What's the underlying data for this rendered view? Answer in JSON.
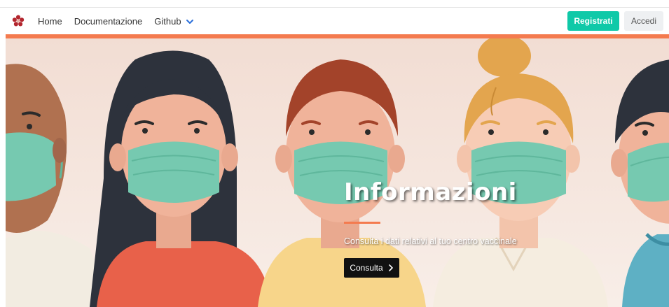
{
  "nav": {
    "logo": "flower-logo-icon",
    "links": [
      "Home",
      "Documentazione"
    ],
    "dropdown_label": "Github",
    "dropdown_icon": "chevron-down-icon",
    "register_label": "Registrati",
    "login_label": "Accedi"
  },
  "hero": {
    "title": "Informazioni",
    "subtitle": "Consulta i dati relativi al tuo centro vaccinale",
    "button_label": "Consulta",
    "button_icon": "chevron-right-icon",
    "illustration": "people-wearing-masks-illustration"
  },
  "colors": {
    "brand_accent": "#f47b4f",
    "register_button": "#0fc9a8",
    "login_button": "#eef0f2",
    "cta_button": "#111111",
    "mask": "#76c9b0"
  }
}
